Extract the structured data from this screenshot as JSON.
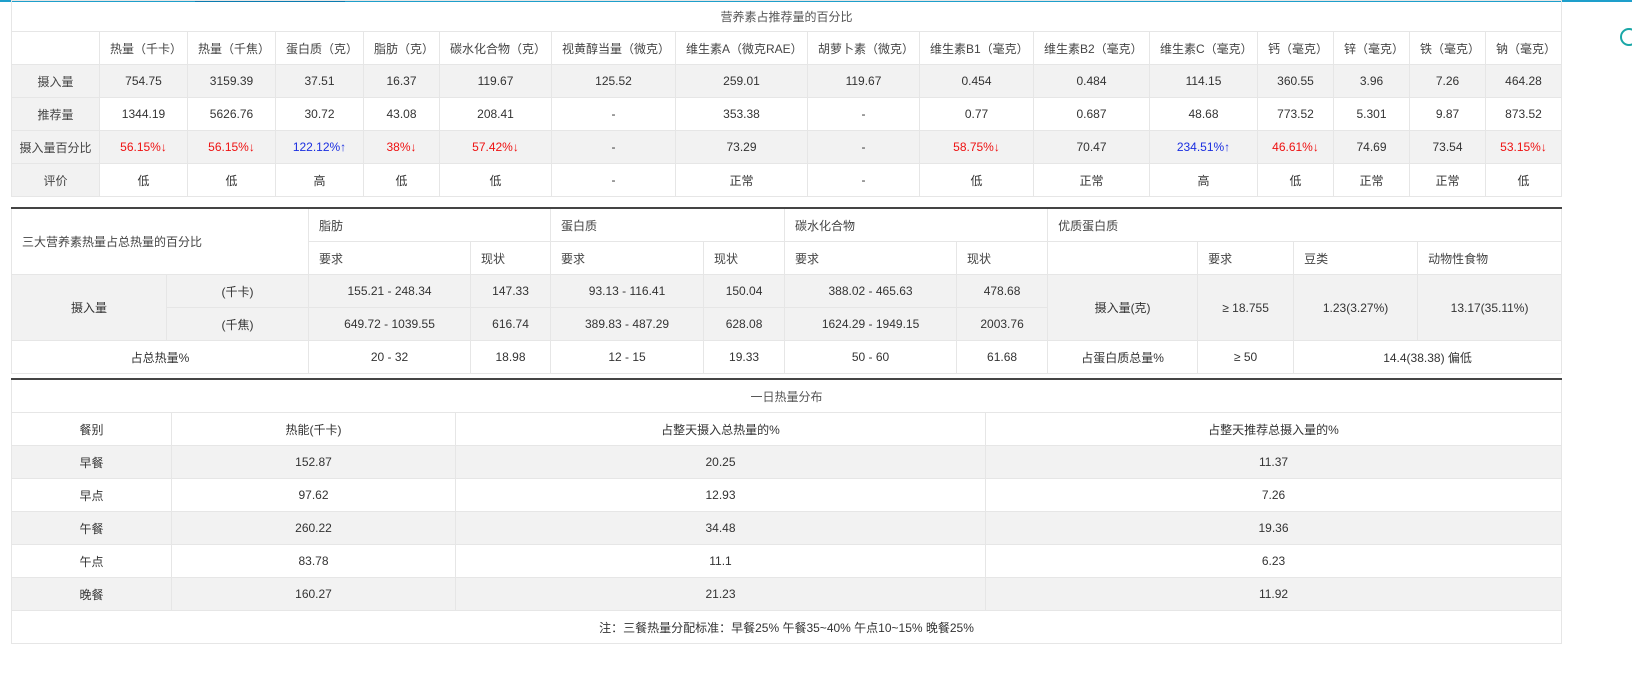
{
  "nutrient_table": {
    "title": "营养素占推荐量的百分比",
    "headers": [
      "",
      "热量（千卡）",
      "热量（千焦）",
      "蛋白质（克）",
      "脂肪（克）",
      "碳水化合物（克）",
      "视黄醇当量（微克）",
      "维生素A（微克RAE）",
      "胡萝卜素（微克）",
      "维生素B1（毫克）",
      "维生素B2（毫克）",
      "维生素C（毫克）",
      "钙（毫克）",
      "锌（毫克）",
      "铁（毫克）",
      "钠（毫克）"
    ],
    "rows": [
      {
        "label": "摄入量",
        "cells": [
          {
            "v": "754.75"
          },
          {
            "v": "3159.39"
          },
          {
            "v": "37.51"
          },
          {
            "v": "16.37"
          },
          {
            "v": "119.67"
          },
          {
            "v": "125.52"
          },
          {
            "v": "259.01"
          },
          {
            "v": "119.67"
          },
          {
            "v": "0.454"
          },
          {
            "v": "0.484"
          },
          {
            "v": "114.15"
          },
          {
            "v": "360.55"
          },
          {
            "v": "3.96"
          },
          {
            "v": "7.26"
          },
          {
            "v": "464.28"
          }
        ]
      },
      {
        "label": "推荐量",
        "cells": [
          {
            "v": "1344.19"
          },
          {
            "v": "5626.76"
          },
          {
            "v": "30.72"
          },
          {
            "v": "43.08"
          },
          {
            "v": "208.41"
          },
          {
            "v": "-"
          },
          {
            "v": "353.38"
          },
          {
            "v": "-"
          },
          {
            "v": "0.77"
          },
          {
            "v": "0.687"
          },
          {
            "v": "48.68"
          },
          {
            "v": "773.52"
          },
          {
            "v": "5.301"
          },
          {
            "v": "9.87"
          },
          {
            "v": "873.52"
          }
        ]
      },
      {
        "label": "摄入量百分比",
        "cells": [
          {
            "v": "56.15%↓",
            "c": "red"
          },
          {
            "v": "56.15%↓",
            "c": "red"
          },
          {
            "v": "122.12%↑",
            "c": "blue"
          },
          {
            "v": "38%↓",
            "c": "red"
          },
          {
            "v": "57.42%↓",
            "c": "red"
          },
          {
            "v": "-"
          },
          {
            "v": "73.29"
          },
          {
            "v": "-"
          },
          {
            "v": "58.75%↓",
            "c": "red"
          },
          {
            "v": "70.47"
          },
          {
            "v": "234.51%↑",
            "c": "blue"
          },
          {
            "v": "46.61%↓",
            "c": "red"
          },
          {
            "v": "74.69"
          },
          {
            "v": "73.54"
          },
          {
            "v": "53.15%↓",
            "c": "red"
          }
        ]
      },
      {
        "label": "评价",
        "cells": [
          {
            "v": "低"
          },
          {
            "v": "低"
          },
          {
            "v": "高"
          },
          {
            "v": "低"
          },
          {
            "v": "低"
          },
          {
            "v": "-"
          },
          {
            "v": "正常"
          },
          {
            "v": "-"
          },
          {
            "v": "低"
          },
          {
            "v": "正常"
          },
          {
            "v": "高"
          },
          {
            "v": "低"
          },
          {
            "v": "正常"
          },
          {
            "v": "正常"
          },
          {
            "v": "低"
          }
        ]
      }
    ]
  },
  "macro_table": {
    "title": "三大营养素热量占总热量的百分比",
    "groups": {
      "fat": "脂肪",
      "protein": "蛋白质",
      "carb": "碳水化合物",
      "quality_protein": "优质蛋白质"
    },
    "sub": {
      "req": "要求",
      "status": "现状",
      "soy": "豆类",
      "animal": "动物性食物"
    },
    "intake_label": "摄入量",
    "kcal_label": "(千卡)",
    "kj_label": "(千焦)",
    "kcal": {
      "fat_req": "155.21 - 248.34",
      "fat_now": "147.33",
      "pro_req": "93.13 - 116.41",
      "pro_now": "150.04",
      "carb_req": "388.02 - 465.63",
      "carb_now": "478.68"
    },
    "kj": {
      "fat_req": "649.72 - 1039.55",
      "fat_now": "616.74",
      "pro_req": "389.83 - 487.29",
      "pro_now": "628.08",
      "carb_req": "1624.29 - 1949.15",
      "carb_now": "2003.76"
    },
    "pct_label": "占总热量%",
    "pct": {
      "fat_req": "20 - 32",
      "fat_now": "18.98",
      "pro_req": "12  - 15",
      "pro_now": "19.33",
      "carb_req": "50 - 60",
      "carb_now": "61.68"
    },
    "qp_intake_label": "摄入量(克)",
    "qp_intake_req": "≥ 18.755",
    "qp_soy": "1.23(3.27%)",
    "qp_animal": "13.17(35.11%)",
    "qp_pct_label": "占蛋白质总量%",
    "qp_pct_req": "≥ 50",
    "qp_pct_val": "14.4(38.38) 偏低"
  },
  "meal_table": {
    "title": "一日热量分布",
    "headers": [
      "餐别",
      "热能(千卡)",
      "占整天摄入总热量的%",
      "占整天推荐总摄入量的%"
    ],
    "rows": [
      [
        "早餐",
        "152.87",
        "20.25",
        "11.37"
      ],
      [
        "早点",
        "97.62",
        "12.93",
        "7.26"
      ],
      [
        "午餐",
        "260.22",
        "34.48",
        "19.36"
      ],
      [
        "午点",
        "83.78",
        "11.1",
        "6.23"
      ],
      [
        "晚餐",
        "160.27",
        "21.23",
        "11.92"
      ]
    ],
    "note": "注：三餐热量分配标准：早餐25% 午餐35~40% 午点10~15% 晚餐25%"
  }
}
